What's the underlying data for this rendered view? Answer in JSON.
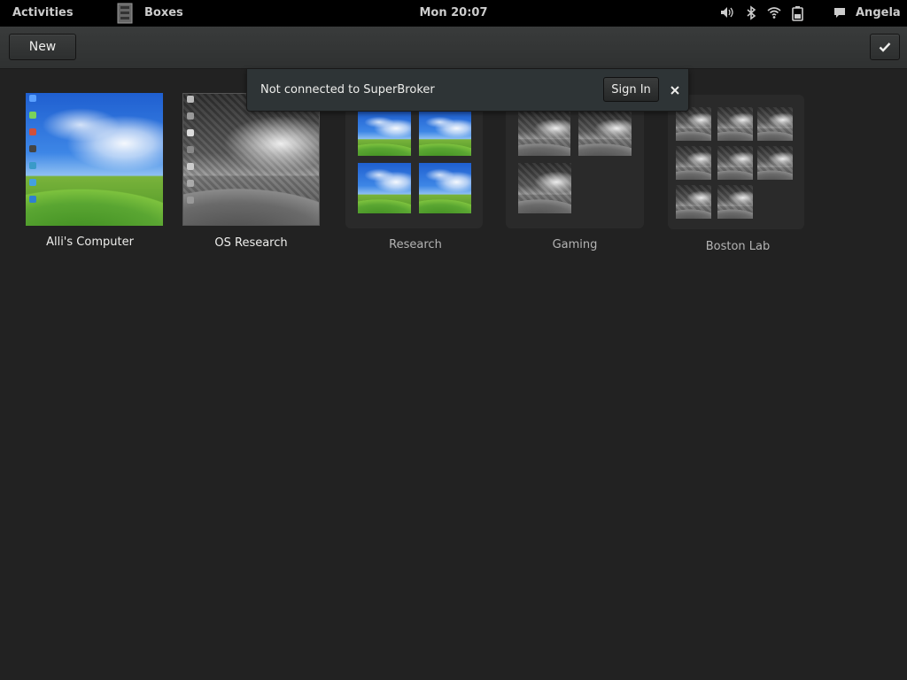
{
  "topbar": {
    "activities": "Activities",
    "app_name": "Boxes",
    "clock": "Mon 20:07",
    "user": "Angela",
    "tray_icons": [
      "volume-icon",
      "bluetooth-icon",
      "wifi-icon",
      "battery-icon",
      "chat-icon"
    ]
  },
  "toolbar": {
    "new_label": "New",
    "select_icon": "checkmark-icon"
  },
  "notification": {
    "message": "Not connected to SuperBroker",
    "action_label": "Sign In",
    "close_icon": "close-icon"
  },
  "items": [
    {
      "label": "Alli's Computer",
      "kind": "machine"
    },
    {
      "label": "OS Research",
      "kind": "machine"
    },
    {
      "label": "Research",
      "kind": "collection"
    },
    {
      "label": "Gaming",
      "kind": "collection"
    },
    {
      "label": "Boston Lab",
      "kind": "collection"
    }
  ],
  "colors": {
    "background": "#222222",
    "topbar": "#000000",
    "toolbar": "#343636",
    "notification": "#2e3436"
  }
}
